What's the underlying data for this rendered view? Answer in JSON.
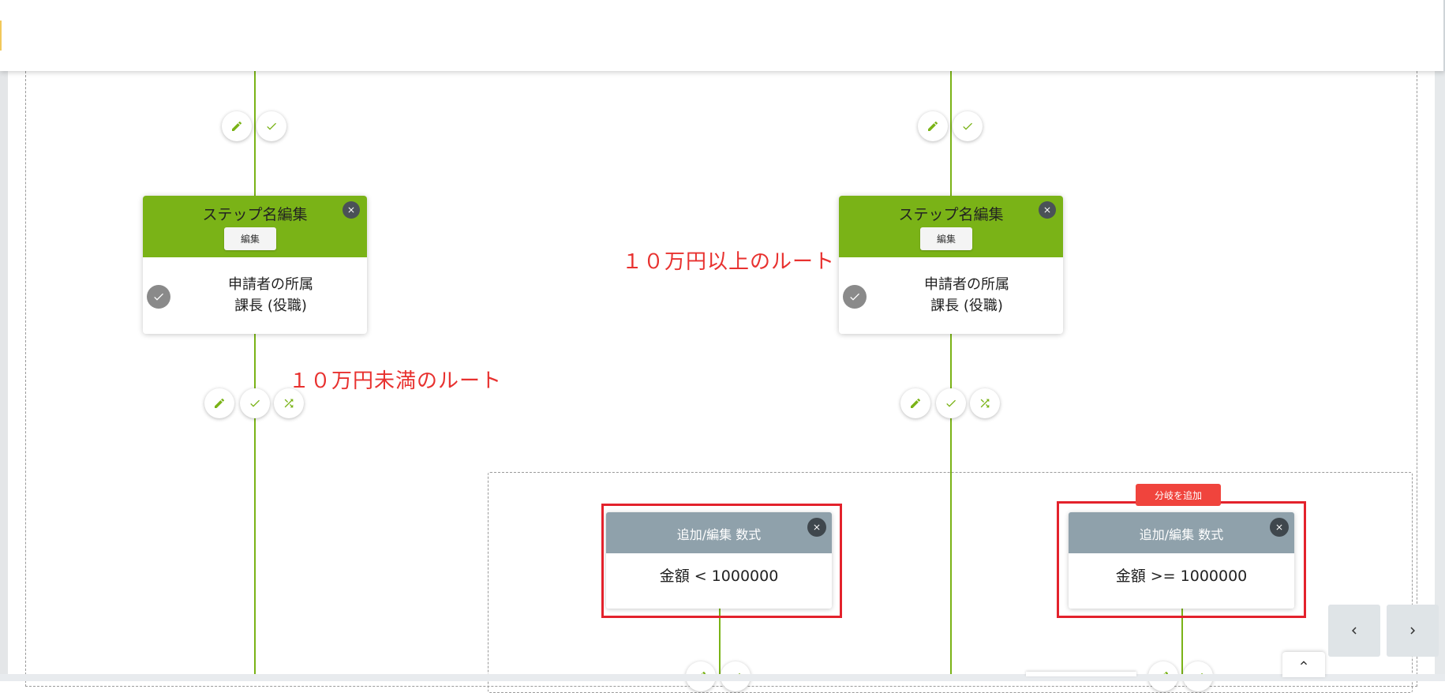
{
  "step_cards": [
    {
      "title": "ステップ名編集",
      "edit_label": "編集",
      "line1": "申請者の所属",
      "line2": "課長 (役職)"
    },
    {
      "title": "ステップ名編集",
      "edit_label": "編集",
      "line1": "申請者の所属",
      "line2": "課長 (役職)"
    }
  ],
  "route_labels": {
    "under": "１０万円未満のルート",
    "over": "１０万円以上のルート"
  },
  "formula_cards": [
    {
      "title": "追加/編集 数式",
      "expression": "金額 < 1000000"
    },
    {
      "title": "追加/編集 数式",
      "expression": "金額 >= 1000000"
    }
  ],
  "add_branch_label": "分岐を追加",
  "icons": {
    "edit": "pencil-icon",
    "approve": "check-icon",
    "branch": "shuffle-icon",
    "close": "close-icon",
    "prev": "chevron-left-icon",
    "next": "chevron-right-icon",
    "scroll_top": "chevron-up-icon"
  },
  "colors": {
    "flow_green": "#7ab317",
    "formula_header": "#8fa1ab",
    "highlight_red": "#e3222c",
    "label_red": "#e8312f",
    "add_branch": "#f0443d"
  }
}
